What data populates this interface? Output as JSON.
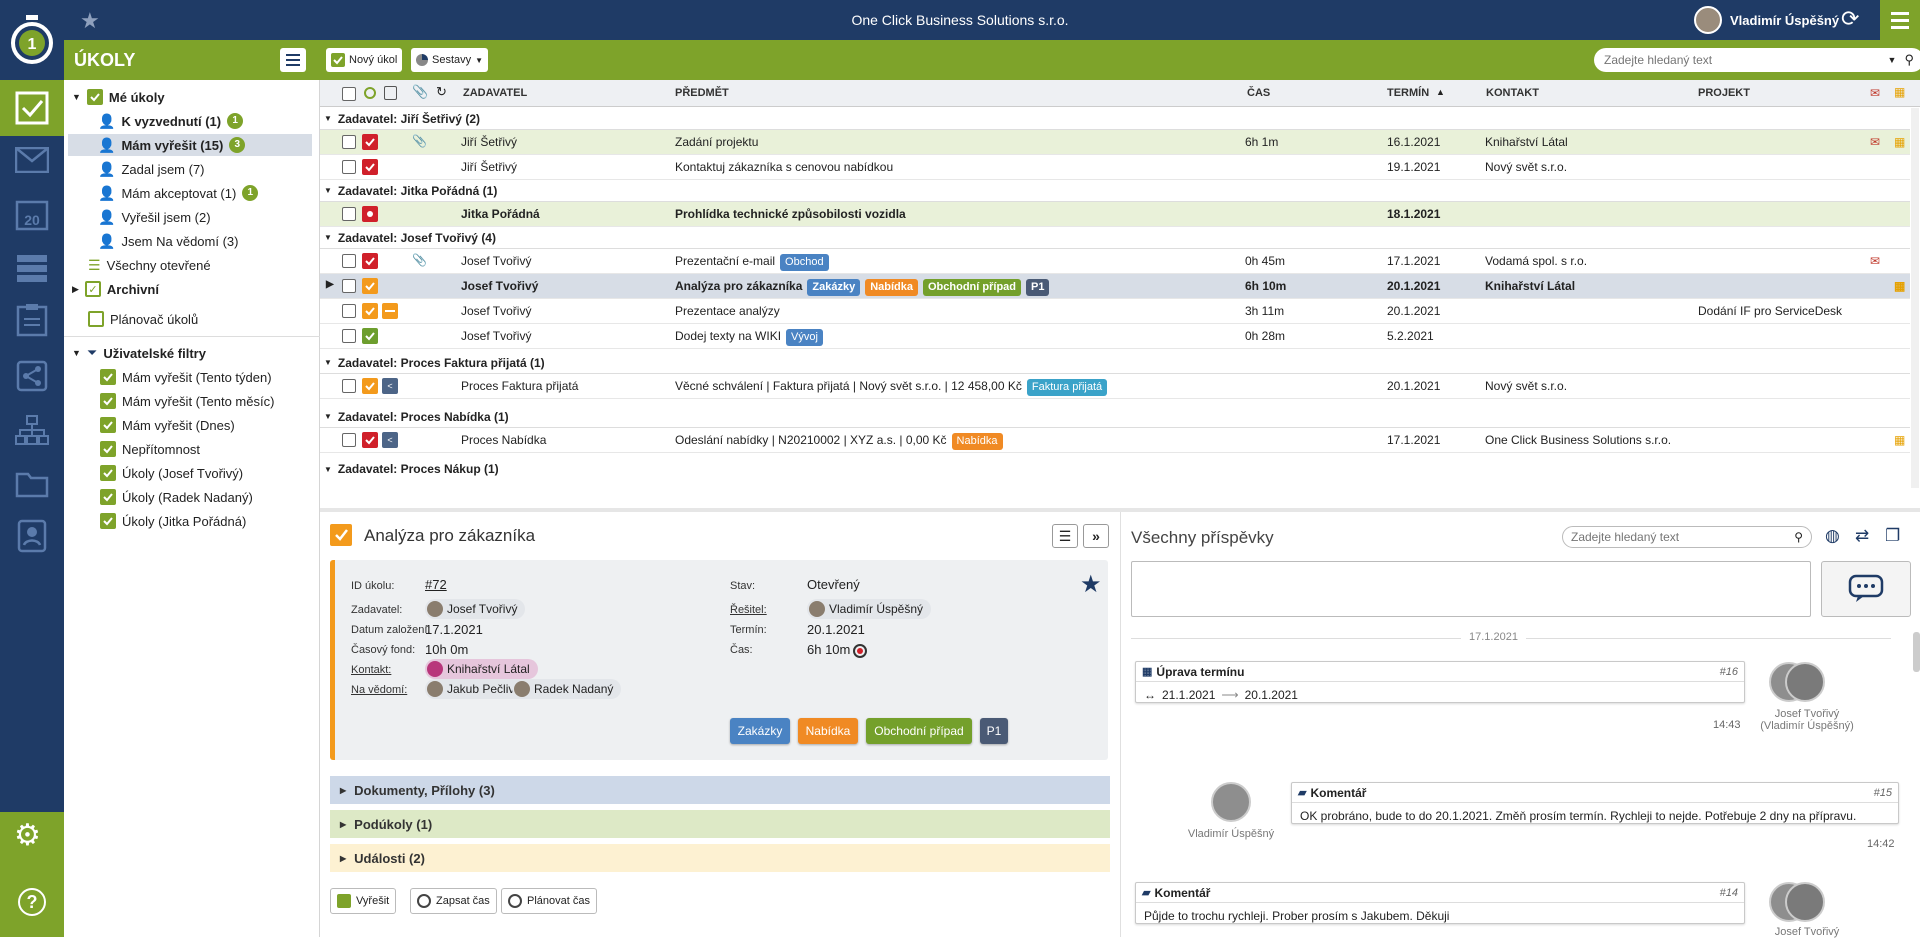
{
  "app": {
    "company": "One Click Business Solutions s.r.o.",
    "user_name": "Vladimír Úspěšný",
    "logo_digit": "1",
    "module_title": "ÚKOLY"
  },
  "toolbar": {
    "new_task": "Nový úkol",
    "reports": "Sestavy",
    "search_placeholder": "Zadejte hledaný text"
  },
  "tree": {
    "my_tasks": "Mé úkoly",
    "items": [
      {
        "label": "K vyzvednutí (1)",
        "badge": "1"
      },
      {
        "label": "Mám vyřešit (15)",
        "badge": "3"
      },
      {
        "label": "Zadal jsem (7)",
        "badge": ""
      },
      {
        "label": "Mám akceptovat (1)",
        "badge": "1"
      },
      {
        "label": "Vyřešil jsem (2)",
        "badge": ""
      },
      {
        "label": "Jsem Na vědomí (3)",
        "badge": ""
      }
    ],
    "all_open": "Všechny otevřené",
    "archive": "Archivní",
    "planner": "Plánovač úkolů",
    "user_filters": "Uživatelské filtry",
    "filters": [
      "Mám vyřešit (Tento týden)",
      "Mám vyřešit (Tento měsíc)",
      "Mám vyřešit (Dnes)",
      "Nepřítomnost",
      "Úkoly (Josef Tvořivý)",
      "Úkoly (Radek Nadaný)",
      "Úkoly (Jitka Pořádná)"
    ]
  },
  "grid": {
    "headers": {
      "requester": "ZADAVATEL",
      "subject": "PŘEDMĚT",
      "time": "ČAS",
      "deadline": "TERMÍN",
      "contact": "KONTAKT",
      "project": "PROJEKT"
    },
    "groups": [
      {
        "title": "Zadavatel: Jiří Šetřivý (2)"
      },
      {
        "title": "Zadavatel: Jitka Pořádná (1)"
      },
      {
        "title": "Zadavatel: Josef Tvořivý (4)"
      },
      {
        "title": "Zadavatel: Proces Faktura přijatá (1)"
      },
      {
        "title": "Zadavatel: Proces Nabídka (1)"
      },
      {
        "title": "Zadavatel: Proces Nákup (1)"
      }
    ],
    "rows": [
      {
        "requester": "Jiří Šetřivý",
        "subject": "Zadání projektu",
        "time": "6h 1m",
        "deadline": "16.1.2021",
        "contact": "Knihařství Látal",
        "project": "",
        "tags": []
      },
      {
        "requester": "Jiří Šetřivý",
        "subject": "Kontaktuj zákazníka s cenovou nabídkou",
        "time": "",
        "deadline": "19.1.2021",
        "contact": "Nový svět s.r.o.",
        "project": "",
        "tags": []
      },
      {
        "requester": "Jitka Pořádná",
        "subject": "Prohlídka technické způsobilosti vozidla",
        "time": "",
        "deadline": "18.1.2021",
        "contact": "",
        "project": "",
        "tags": []
      },
      {
        "requester": "Josef Tvořivý",
        "subject": "Prezentační e-mail",
        "time": "0h 45m",
        "deadline": "17.1.2021",
        "contact": "Vodamá spol. s r.o.",
        "project": "",
        "tags": [
          "Obchod"
        ]
      },
      {
        "requester": "Josef Tvořivý",
        "subject": "Analýza pro zákazníka",
        "time": "6h 10m",
        "deadline": "20.1.2021",
        "contact": "Knihařství Látal",
        "project": "",
        "tags": [
          "Zakázky",
          "Nabídka",
          "Obchodní případ",
          "P1"
        ]
      },
      {
        "requester": "Josef Tvořivý",
        "subject": "Prezentace analýzy",
        "time": "3h 11m",
        "deadline": "20.1.2021",
        "contact": "",
        "project": "Dodání IF pro ServiceDesk",
        "tags": []
      },
      {
        "requester": "Josef Tvořivý",
        "subject": "Dodej texty na WIKI",
        "time": "0h 28m",
        "deadline": "5.2.2021",
        "contact": "",
        "project": "",
        "tags": [
          "Vývoj"
        ]
      },
      {
        "requester": "Proces Faktura přijatá",
        "subject": "Věcné schválení | Faktura přijatá | Nový svět s.r.o. | 12 458,00 Kč",
        "time": "",
        "deadline": "20.1.2021",
        "contact": "Nový svět s.r.o.",
        "project": "",
        "tags": [
          "Faktura přijatá"
        ]
      },
      {
        "requester": "Proces Nabídka",
        "subject": "Odeslání nabídky | N20210002 | XYZ a.s. | 0,00 Kč",
        "time": "",
        "deadline": "17.1.2021",
        "contact": "One Click Business Solutions s.r.o.",
        "project": "",
        "tags": [
          "Nabídka"
        ]
      }
    ]
  },
  "detail": {
    "title": "Analýza pro zákazníka",
    "labels": {
      "id": "ID úkolu:",
      "requester": "Zadavatel:",
      "created": "Datum založení:",
      "fund": "Časový fond:",
      "contact": "Kontakt:",
      "cc": "Na vědomí:",
      "status": "Stav:",
      "solver": "Řešitel:",
      "deadline": "Termín:",
      "time": "Čas:"
    },
    "id": "#72",
    "requester": "Josef Tvořivý",
    "created": "17.1.2021",
    "fund": "10h 0m",
    "contact": "Knihařství Látal",
    "cc": [
      "Jakub Pečlivý",
      "Radek Nadaný"
    ],
    "status": "Otevřený",
    "solver": "Vladimír Úspěšný",
    "deadline": "20.1.2021",
    "time": "6h 10m",
    "tags": [
      "Zakázky",
      "Nabídka",
      "Obchodní případ",
      "P1"
    ],
    "sections": [
      "Dokumenty, Přílohy (3)",
      "Podúkoly (1)",
      "Události (2)"
    ],
    "actions": [
      "Vyřešit",
      "Zapsat čas",
      "Plánovat čas"
    ]
  },
  "feed": {
    "title": "Všechny příspěvky",
    "search_placeholder": "Zadejte hledaný text",
    "date_sep": "17.1.2021",
    "posts": [
      {
        "type": "Úprava termínu",
        "num": "#16",
        "from": "21.1.2021",
        "to": "20.1.2021",
        "time": "14:43",
        "author": "Josef Tvořivý (Vladimír Úspěšný)"
      },
      {
        "type": "Komentář",
        "num": "#15",
        "text": "OK probráno, bude to do 20.1.2021. Změň prosím termín. Rychleji to nejde. Potřebuje 2 dny na přípravu.",
        "time": "14:42",
        "author": "Vladimír Úspěšný"
      },
      {
        "type": "Komentář",
        "num": "#14",
        "text": "Půjde to trochu rychleji. Prober prosím s Jakubem. Děkuji",
        "author": "Josef Tvořivý"
      }
    ]
  },
  "colors": {
    "navy": "#1f3b66",
    "green": "#7ea32a",
    "orange": "#f39a1c",
    "red": "#d0202a"
  }
}
